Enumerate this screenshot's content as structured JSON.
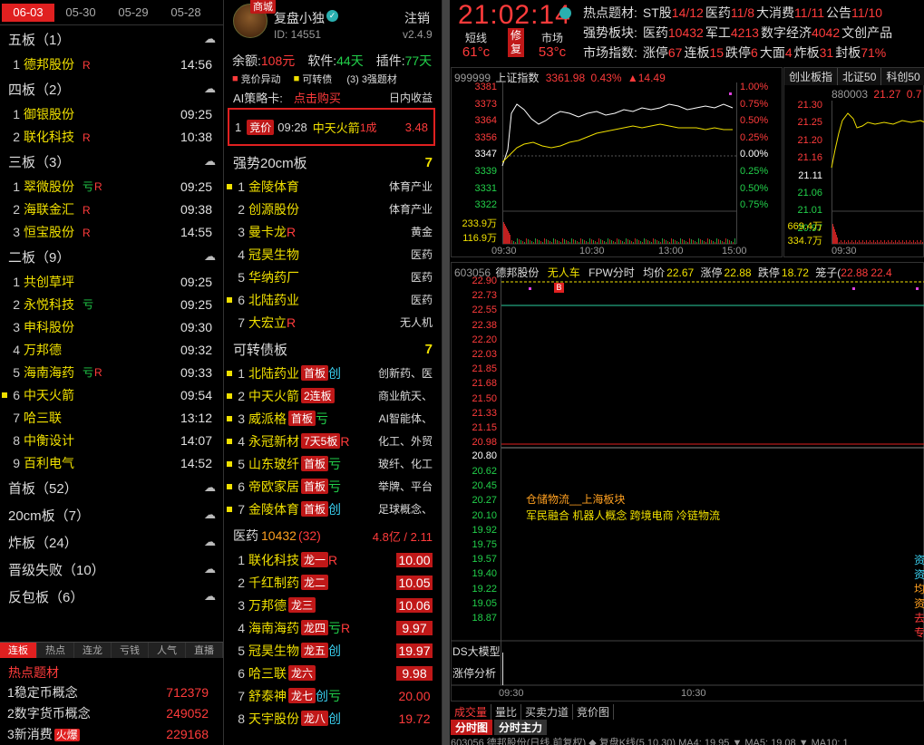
{
  "left": {
    "date_tabs": [
      "06-03",
      "05-30",
      "05-29",
      "05-28"
    ],
    "groups": [
      {
        "title": "五板（1）",
        "rows": [
          {
            "n": "1",
            "name": "德邦股份",
            "tag": "R",
            "time": "14:56"
          }
        ]
      },
      {
        "title": "四板（2）",
        "rows": [
          {
            "n": "1",
            "name": "御银股份",
            "tag": "",
            "time": "09:25"
          },
          {
            "n": "2",
            "name": "联化科技",
            "tag": "R",
            "time": "10:38"
          }
        ]
      },
      {
        "title": "三板（3）",
        "rows": [
          {
            "n": "1",
            "name": "翠微股份",
            "tag": "亏R",
            "time": "09:25"
          },
          {
            "n": "2",
            "name": "海联金汇",
            "tag": "R",
            "time": "09:38"
          },
          {
            "n": "3",
            "name": "恒宝股份",
            "tag": "R",
            "time": "14:55"
          }
        ]
      },
      {
        "title": "二板（9）",
        "rows": [
          {
            "n": "1",
            "name": "共创草坪",
            "tag": "",
            "time": "09:25"
          },
          {
            "n": "2",
            "name": "永悦科技",
            "tag": "亏",
            "time": "09:25"
          },
          {
            "n": "3",
            "name": "申科股份",
            "tag": "",
            "time": "09:30"
          },
          {
            "n": "4",
            "name": "万邦德",
            "tag": "",
            "time": "09:32"
          },
          {
            "n": "5",
            "name": "海南海药",
            "tag": "亏R",
            "time": "09:33"
          },
          {
            "n": "6",
            "name": "中天火箭",
            "tag": "",
            "time": "09:54",
            "mark": true
          },
          {
            "n": "7",
            "name": "哈三联",
            "tag": "",
            "time": "13:12"
          },
          {
            "n": "8",
            "name": "中衡设计",
            "tag": "",
            "time": "14:07"
          },
          {
            "n": "9",
            "name": "百利电气",
            "tag": "",
            "time": "14:52"
          }
        ]
      }
    ],
    "more_groups": [
      "首板（52）",
      "20cm板（7）",
      "炸板（24）",
      "晋级失败（10）",
      "反包板（6）"
    ],
    "bottom_tabs": [
      "连板",
      "热点",
      "连龙",
      "亏钱",
      "人气",
      "直播"
    ],
    "hot_title": "热点题材",
    "hot_rows": [
      {
        "name": "1稳定币概念",
        "badge": "",
        "value": "712379"
      },
      {
        "name": "2数字货币概念",
        "badge": "",
        "value": "249052"
      },
      {
        "name": "3新消费",
        "badge": "火爆",
        "value": "229168"
      }
    ]
  },
  "mid": {
    "shop_badge": "商城",
    "user_name": "复盘小独",
    "logout": "注销",
    "user_id": "ID: 14551",
    "version": "v2.4.9",
    "balance_label": "余额:",
    "balance_value": "108元",
    "soft_label": "软件:",
    "soft_value": "44天",
    "plugin_label": "插件:",
    "plugin_value": "77天",
    "legend1": "竞价异动",
    "legend2": "可转债",
    "legend3": "(3) 3强题材",
    "ai_title": "AI策略卡:",
    "ai_buy": "点击购买",
    "ai_right": "日内收益",
    "ai_row": {
      "n": "1",
      "badge": "竞价",
      "time": "09:28",
      "name": "中天火箭",
      "extra": "1成",
      "value": "3.48"
    },
    "sec1": {
      "title": "强势20cm板",
      "count": "7",
      "rows": [
        {
          "n": "1",
          "name": "金陵体育",
          "tag": "",
          "cat": "体育产业",
          "mark": true
        },
        {
          "n": "2",
          "name": "创源股份",
          "tag": "",
          "cat": "体育产业"
        },
        {
          "n": "3",
          "name": "曼卡龙",
          "tag": "R",
          "cat": "黄金"
        },
        {
          "n": "4",
          "name": "冠昊生物",
          "tag": "",
          "cat": "医药"
        },
        {
          "n": "5",
          "name": "华纳药厂",
          "tag": "",
          "cat": "医药"
        },
        {
          "n": "6",
          "name": "北陆药业",
          "tag": "",
          "cat": "医药",
          "mark": true
        },
        {
          "n": "7",
          "name": "大宏立",
          "tag": "R",
          "cat": "无人机"
        }
      ]
    },
    "sec2": {
      "title": "可转债板",
      "count": "7",
      "rows": [
        {
          "n": "1",
          "name": "北陆药业",
          "badge": "首板",
          "tag": "创",
          "cat": "创新药、医"
        },
        {
          "n": "2",
          "name": "中天火箭",
          "badge": "2连板",
          "tag": "",
          "cat": "商业航天、"
        },
        {
          "n": "3",
          "name": "威派格",
          "badge": "首板",
          "tag": "亏",
          "cat": "AI智能体、"
        },
        {
          "n": "4",
          "name": "永冠新材",
          "badge": "7天5板",
          "tag": "R",
          "cat": "化工、外贸"
        },
        {
          "n": "5",
          "name": "山东玻纤",
          "badge": "首板",
          "tag": "亏",
          "cat": "玻纤、化工"
        },
        {
          "n": "6",
          "name": "帝欧家居",
          "badge": "首板",
          "tag": "亏",
          "cat": "举牌、平台"
        },
        {
          "n": "7",
          "name": "金陵体育",
          "badge": "首板",
          "tag": "创",
          "cat": "足球概念、"
        }
      ]
    },
    "sec3": {
      "title": "医药",
      "num": "10432",
      "count": "(32)",
      "amt": "4.8亿 / 2.11",
      "rows": [
        {
          "n": "1",
          "name": "联化科技",
          "badge": "龙一",
          "tag": "R",
          "pct": "10.00"
        },
        {
          "n": "2",
          "name": "千红制药",
          "badge": "龙二",
          "tag": "",
          "pct": "10.05"
        },
        {
          "n": "3",
          "name": "万邦德",
          "badge": "龙三",
          "tag": "",
          "pct": "10.06"
        },
        {
          "n": "4",
          "name": "海南海药",
          "badge": "龙四",
          "tag": "亏R",
          "pct": "9.97"
        },
        {
          "n": "5",
          "name": "冠昊生物",
          "badge": "龙五",
          "tag": "创",
          "pct": "19.97"
        },
        {
          "n": "6",
          "name": "哈三联",
          "badge": "龙六",
          "tag": "",
          "pct": "9.98"
        },
        {
          "n": "7",
          "name": "舒泰神",
          "badge": "龙七",
          "tag": "创亏",
          "pct": "20.00",
          "plain": true
        },
        {
          "n": "8",
          "name": "天宇股份",
          "badge": "龙八",
          "tag": "创",
          "pct": "19.72",
          "plain": true
        }
      ]
    }
  },
  "right": {
    "clock": "21:02:14",
    "labels": [
      {
        "t": "短线",
        "v": "61°c"
      },
      {
        "t": "市场",
        "v": "53°c"
      }
    ],
    "xiufu": "修复",
    "hot_label": "热点题材:",
    "hot_items": [
      {
        "name": "ST股",
        "v": "14/12"
      },
      {
        "name": "医药",
        "v": "11/8"
      },
      {
        "name": "大消费",
        "v": "11/11"
      },
      {
        "name": "公告",
        "v": "11/10"
      }
    ],
    "strong_label": "强势板块:",
    "strong_items": [
      {
        "name": "医药",
        "v": "10432"
      },
      {
        "name": "军工",
        "v": "4213"
      },
      {
        "name": "数字经济",
        "v": "4042"
      },
      {
        "name": "文创产品",
        "v": ""
      }
    ],
    "market_label": "市场指数:",
    "market_items": [
      {
        "name": "涨停",
        "v": "67"
      },
      {
        "name": "连板",
        "v": "15"
      },
      {
        "name": "跌停",
        "v": "6"
      },
      {
        "name": "大面",
        "v": "4"
      },
      {
        "name": "炸板",
        "v": "31"
      },
      {
        "name": "封板",
        "v": "71%"
      }
    ],
    "index_code": "999999",
    "index_name": "上证指数",
    "index_val": "3361.98",
    "index_pct": "0.43%",
    "index_chg": "▲14.49",
    "idx_y": [
      "3381",
      "3373",
      "3364",
      "3356",
      "3347",
      "3339",
      "3331",
      "3322"
    ],
    "idx_pct": [
      "1.00%",
      "0.75%",
      "0.50%",
      "0.25%",
      "0.00%",
      "0.25%",
      "0.50%",
      "0.75%"
    ],
    "idx_vol": [
      "233.9万",
      "116.9万"
    ],
    "idx_x": [
      "09:30",
      "10:30",
      "13:00",
      "15:00"
    ],
    "side_tabs": [
      "创业板指",
      "北证50",
      "科创50"
    ],
    "side_code": "880003",
    "side_val": "21.27",
    "side_pct": "0.7",
    "side_y": [
      "21.30",
      "21.25",
      "21.20",
      "21.16",
      "21.11",
      "21.06",
      "21.01",
      "20.97"
    ],
    "side_vol": [
      "669.4万",
      "334.7万"
    ],
    "side_x": "09:30",
    "stock_code": "603056",
    "stock_name": "德邦股份",
    "stock_tag": "无人车",
    "fpw": "FPW分时",
    "avg_label": "均价",
    "avg_val": "22.67",
    "up_label": "涨停",
    "up_val": "22.88",
    "down_label": "跌停",
    "down_val": "18.72",
    "cage_label": "笼子(",
    "cage_val": "22.88",
    "cage_rest": "22.4",
    "stk_y_red": [
      "22.90",
      "22.73",
      "22.55",
      "22.38",
      "22.20",
      "22.03",
      "21.85",
      "21.68",
      "21.50",
      "21.33",
      "21.15",
      "20.98"
    ],
    "stk_mid": "20.80",
    "stk_y_grn": [
      "20.62",
      "20.45",
      "20.27",
      "20.10",
      "19.92",
      "19.75",
      "19.57",
      "19.40",
      "19.22",
      "19.05",
      "18.87"
    ],
    "concept1": "仓储物流__上海板块",
    "concept2": "军民融合 机器人概念 跨境电商 冷链物流",
    "ds_btn": "DS大模型",
    "zt_btn": "涨停分析",
    "stk_x": [
      "09:30",
      "10:30"
    ],
    "b_marker": "B",
    "bottom_tabs1": [
      "成交量",
      "量比",
      "买卖力道",
      "竞价图"
    ],
    "bottom_tabs2": [
      "分时图",
      "分时主力"
    ],
    "footer": "603056 德邦股份(日线,前复权) ◆ 复盘K线(5.10.30) MA4: 19.95 ▼ MA5: 19.08 ▼ MA10: 1"
  }
}
